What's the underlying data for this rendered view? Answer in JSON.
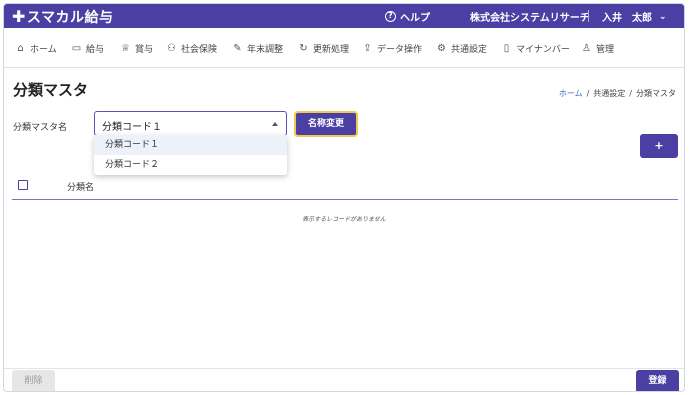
{
  "app": {
    "logo_plus": "✚",
    "logo_text": "スマカル給与"
  },
  "header": {
    "help_icon": "?",
    "help_label": "ヘルプ",
    "company": "株式会社システムリサーチ",
    "user_name": "入井　太郎",
    "user_chevron": "⌄"
  },
  "nav": {
    "items": [
      {
        "icon": "⌂",
        "label": "ホーム"
      },
      {
        "icon": "▭",
        "label": "給与"
      },
      {
        "icon": "♕",
        "label": "賞与"
      },
      {
        "icon": "⚇",
        "label": "社会保険"
      },
      {
        "icon": "✎",
        "label": "年末調整"
      },
      {
        "icon": "↻",
        "label": "更新処理"
      },
      {
        "icon": "⇪",
        "label": "データ操作"
      },
      {
        "icon": "⚙",
        "label": "共通設定"
      },
      {
        "icon": "▯",
        "label": "マイナンバー"
      },
      {
        "icon": "♙",
        "label": "管理"
      }
    ]
  },
  "page": {
    "title": "分類マスタ"
  },
  "breadcrumb": {
    "home": "ホーム",
    "sep1": "/",
    "parent": "共通設定",
    "sep2": "/",
    "current": "分類マスタ"
  },
  "form": {
    "master_label": "分類マスタ名",
    "selected": "分類コード１",
    "rename_button": "名称変更",
    "options": [
      "分類コード１",
      "分類コード２"
    ]
  },
  "add_button": "+",
  "table": {
    "column_name": "分類名",
    "empty_message": "表示するレコードがありません"
  },
  "footer": {
    "delete_button": "削除",
    "save_button": "登録"
  },
  "colors": {
    "brand": "#4b3fa3",
    "focus_ring": "#f2c94c",
    "link": "#3a6fd0"
  }
}
